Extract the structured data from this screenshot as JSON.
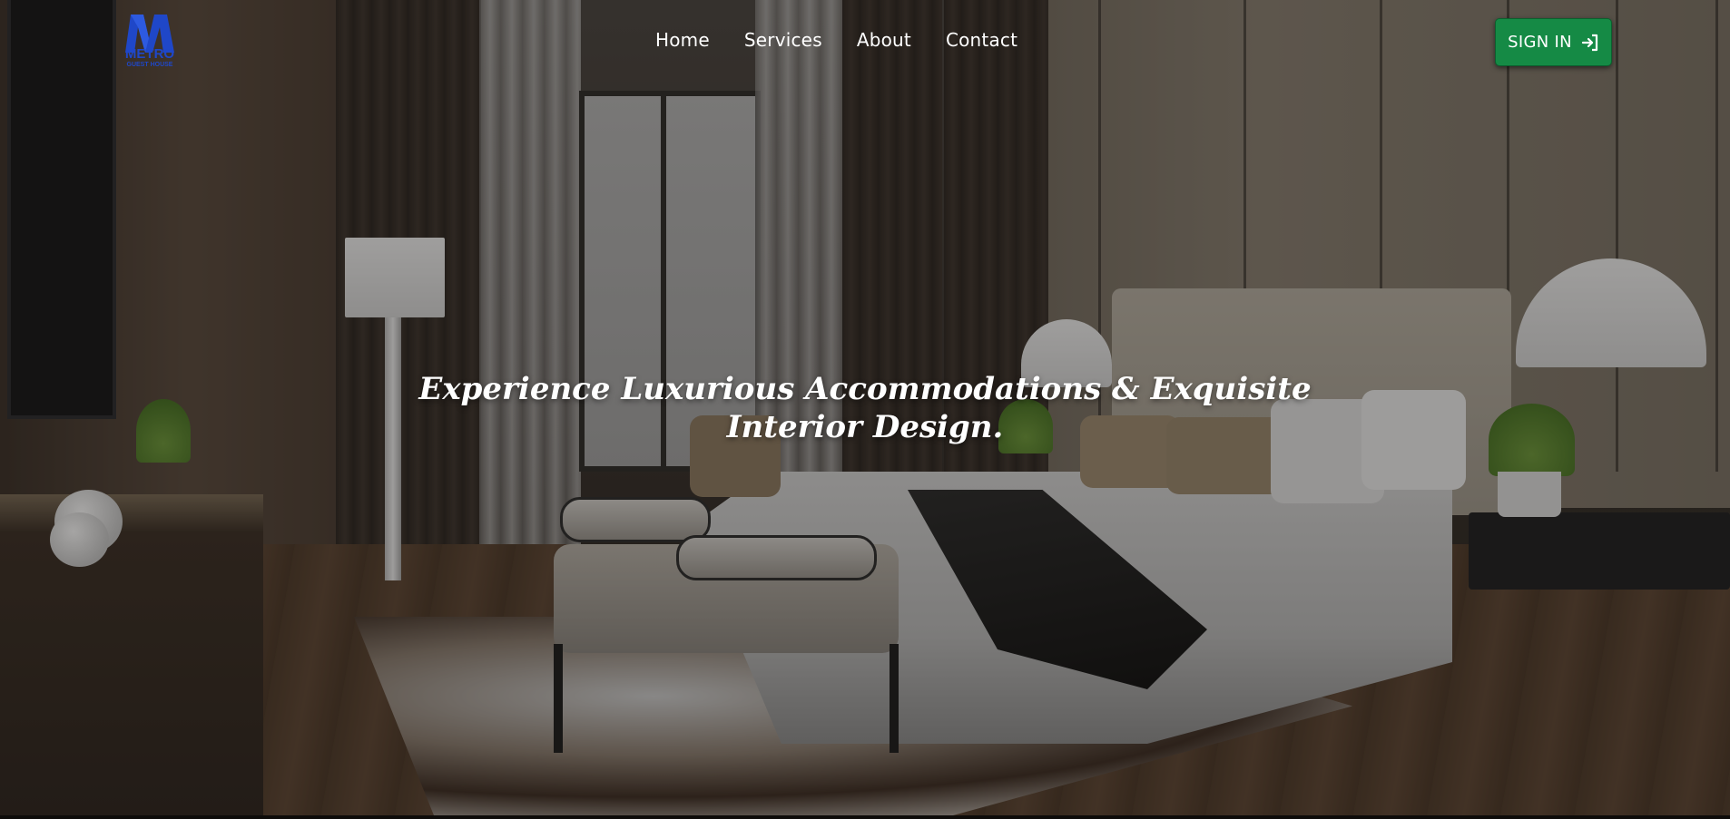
{
  "brand": {
    "name": "METRO",
    "subtitle": "GUEST HOUSE",
    "color": "#1f47c8",
    "icon": "metro-m-logo-icon"
  },
  "nav": {
    "items": [
      {
        "label": "Home"
      },
      {
        "label": "Services"
      },
      {
        "label": "About"
      },
      {
        "label": "Contact"
      }
    ]
  },
  "header": {
    "signin_label": "SIGN IN",
    "signin_icon": "sign-in-arrow-icon",
    "signin_color": "#158a45"
  },
  "hero": {
    "title": "Experience Luxurious Accommodations & Exquisite Interior Design.",
    "background": "luxury-bedroom-photo"
  }
}
